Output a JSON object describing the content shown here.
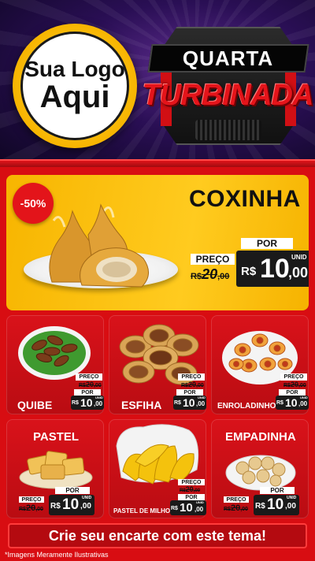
{
  "header": {
    "logo_line1": "Sua Logo",
    "logo_line2": "Aqui",
    "badge_top": "QUARTA",
    "badge_main": "TURBINADA"
  },
  "hero": {
    "discount": "-50%",
    "title": "COXINHA",
    "preco_label": "PREÇO",
    "old_price_int": "20",
    "old_price_cents": ",00",
    "por_label": "POR",
    "currency": "R$",
    "price_int": "10",
    "price_cents": ",00",
    "unit": "UNID"
  },
  "items": [
    {
      "name": "QUIBE",
      "preco_label": "PREÇO",
      "old_int": "20",
      "old_cents": ",00",
      "por_label": "POR",
      "currency": "R$",
      "price_int": "10",
      "price_cents": ",00",
      "unit": "UNID"
    },
    {
      "name": "ESFIHA",
      "preco_label": "PREÇO",
      "old_int": "20",
      "old_cents": ",00",
      "por_label": "POR",
      "currency": "R$",
      "price_int": "10",
      "price_cents": ",00",
      "unit": "UNID"
    },
    {
      "name": "ENROLADINHO",
      "preco_label": "PREÇO",
      "old_int": "20",
      "old_cents": ",00",
      "por_label": "POR",
      "currency": "R$",
      "price_int": "10",
      "price_cents": ",00",
      "unit": "UNID"
    },
    {
      "name": "PASTEL",
      "preco_label": "PREÇO",
      "old_int": "20",
      "old_cents": ",00",
      "por_label": "POR",
      "currency": "R$",
      "price_int": "10",
      "price_cents": ",00",
      "unit": "UNID"
    },
    {
      "name": "PASTEL DE MILHO",
      "preco_label": "PREÇO",
      "old_int": "20",
      "old_cents": ",00",
      "por_label": "POR",
      "currency": "R$",
      "price_int": "10",
      "price_cents": ",00",
      "unit": "UNID"
    },
    {
      "name": "EMPADINHA",
      "preco_label": "PREÇO",
      "old_int": "20",
      "old_cents": ",00",
      "por_label": "POR",
      "currency": "R$",
      "price_int": "10",
      "price_cents": ",00",
      "unit": "UNID"
    }
  ],
  "footer": {
    "cta": "Crie seu encarte com este tema!",
    "disclaimer": "*Imagens Meramente Ilustrativas"
  },
  "colors": {
    "brand_red": "#d80d12",
    "hero_yellow": "#ffc20e",
    "header_purple": "#2a0f55",
    "logo_gold": "#f7b500"
  }
}
